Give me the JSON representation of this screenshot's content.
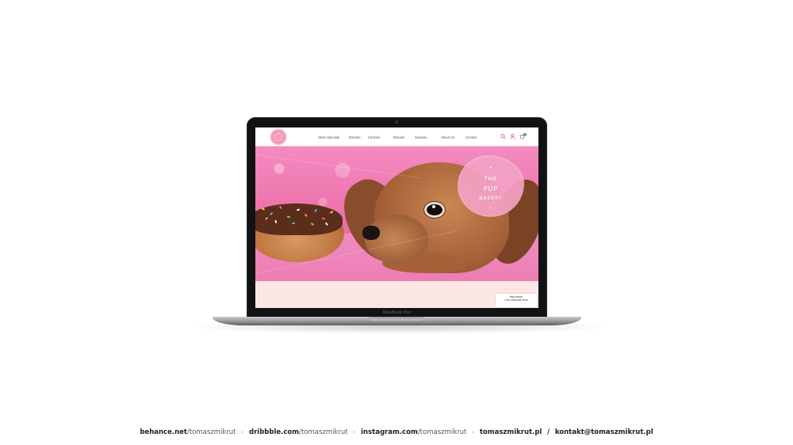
{
  "device": {
    "label": "MacBook Pro"
  },
  "site": {
    "nav": [
      "Store Specials",
      "Donuts",
      "Cookies",
      "Biscuits",
      "Season",
      "About Us",
      "Contact"
    ],
    "dropdown_marker": "▾",
    "hero_badge": {
      "line1": "THE",
      "line2": "PUP",
      "line3": "BAKERY"
    },
    "chat": {
      "line1": "Hey there!",
      "line2": "Live chat with Bob"
    },
    "icons": [
      "search-icon",
      "user-icon",
      "cart-icon"
    ],
    "colors": {
      "accent": "#e05a86",
      "hero_pink": "#ee74ad",
      "badge": "#f4a1c4",
      "background_lower": "#fbe6e6"
    }
  },
  "footer": {
    "items": [
      {
        "bold": "behance.net",
        "light": "/tomaszmikrut"
      },
      {
        "bold": "dribbble.com",
        "light": "/tomaszmikrut"
      },
      {
        "bold": "instagram.com",
        "light": "/tomaszmikrut"
      },
      {
        "bold": "tomaszmikrut.pl",
        "light": ""
      },
      {
        "bold": "kontakt@tomaszmikrut.pl",
        "light": ""
      }
    ],
    "separator_dash": "-",
    "separator_slash": "/"
  }
}
